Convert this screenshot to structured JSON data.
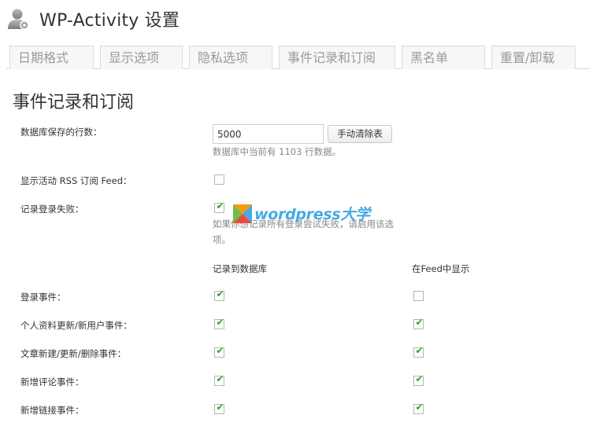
{
  "header": {
    "title": "WP-Activity 设置",
    "icon": "user-gear-icon"
  },
  "tabs": [
    {
      "label": "日期格式"
    },
    {
      "label": "显示选项"
    },
    {
      "label": "隐私选项"
    },
    {
      "label": "事件记录和订阅"
    },
    {
      "label": "黑名单"
    },
    {
      "label": "重置/卸载"
    }
  ],
  "section": {
    "title": "事件记录和订阅"
  },
  "db_rows": {
    "label": "数据库保存的行数：",
    "value": "5000",
    "purge_button": "手动清除表",
    "note": "数据库中当前有 1103 行数据。"
  },
  "rss": {
    "label": "显示活动 RSS 订阅 Feed：",
    "checked": false
  },
  "log_failed": {
    "label": "记录登录失败：",
    "checked": true,
    "note": "如果你想记录所有登录尝试失败，请启用该选项。"
  },
  "columns": {
    "db": "记录到数据库",
    "feed": "在Feed中显示"
  },
  "events": [
    {
      "label": "登录事件：",
      "db": true,
      "feed": false
    },
    {
      "label": "个人资料更新/新用户事件：",
      "db": true,
      "feed": true
    },
    {
      "label": "文章新建/更新/删除事件：",
      "db": true,
      "feed": true
    },
    {
      "label": "新增评论事件：",
      "db": true,
      "feed": true
    },
    {
      "label": "新增链接事件：",
      "db": true,
      "feed": true
    }
  ],
  "watermark": {
    "text": "wordpress大学"
  },
  "colors": {
    "check": "#2ea12e",
    "watermark_blue": "#47a9e6",
    "watermark_green": "#6cc04a",
    "watermark_orange": "#f39c12"
  }
}
